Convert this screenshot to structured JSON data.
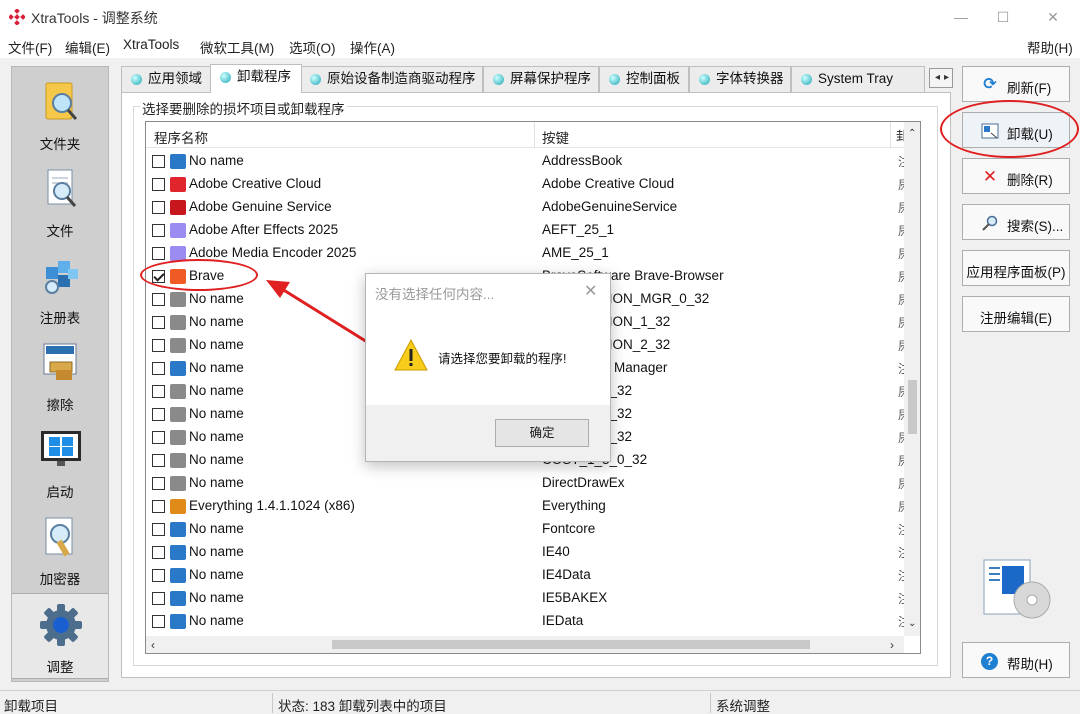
{
  "window": {
    "title": "XtraTools - 调整系统",
    "minimize": "—",
    "maximize": "☐",
    "close": "✕"
  },
  "menu": [
    {
      "label": "文件(F)"
    },
    {
      "label": "编辑(E)"
    },
    {
      "label": "XtraTools"
    },
    {
      "label": "微软工具(M)"
    },
    {
      "label": "选项(O)"
    },
    {
      "label": "操作(A)"
    }
  ],
  "menu_help": "帮助(H)",
  "leftbar": [
    {
      "label": "文件夹",
      "icon": "folder-icon"
    },
    {
      "label": "文件",
      "icon": "file-icon"
    },
    {
      "label": "注册表",
      "icon": "registry-icon"
    },
    {
      "label": "擦除",
      "icon": "eraser-icon"
    },
    {
      "label": "启动",
      "icon": "startup-icon"
    },
    {
      "label": "加密器",
      "icon": "encryptor-icon"
    },
    {
      "label": "调整",
      "icon": "gear-icon"
    }
  ],
  "tabs": [
    {
      "label": "应用领域"
    },
    {
      "label": "卸载程序"
    },
    {
      "label": "原始设备制造商驱动程序"
    },
    {
      "label": "屏幕保护程序"
    },
    {
      "label": "控制面板"
    },
    {
      "label": "字体转换器"
    },
    {
      "label": "System Tray"
    }
  ],
  "group_label": "选择要删除的损坏项目或卸载程序",
  "columns": {
    "name": "程序名称",
    "key": "按键",
    "extra": "卦"
  },
  "rows": [
    {
      "name": "No name",
      "key": "AddressBook",
      "extra": "注",
      "checked": false,
      "icon": "app-icon",
      "color": "#2a78c8"
    },
    {
      "name": "Adobe Creative Cloud",
      "key": "Adobe Creative Cloud",
      "extra": "屄",
      "checked": false,
      "icon": "creative-cloud-icon",
      "color": "#e0262c"
    },
    {
      "name": "Adobe Genuine Service",
      "key": "AdobeGenuineService",
      "extra": "屄",
      "checked": false,
      "icon": "adobe-icon",
      "color": "#c8161d"
    },
    {
      "name": "Adobe After Effects 2025",
      "key": "AEFT_25_1",
      "extra": "屄",
      "checked": false,
      "icon": "after-effects-icon",
      "color": "#9a8cf0"
    },
    {
      "name": "Adobe Media Encoder 2025",
      "key": "AME_25_1",
      "extra": "屄",
      "checked": false,
      "icon": "media-encoder-icon",
      "color": "#9a8cf0"
    },
    {
      "name": "Brave",
      "key": "BraveSoftware Brave-Browser",
      "extra": "屄",
      "checked": true,
      "icon": "brave-icon",
      "color": "#f05a24"
    },
    {
      "name": "No name",
      "key": "CONNECTION_MGR_0_32",
      "extra": "屄",
      "checked": false,
      "icon": "installer-icon",
      "color": "#8a8a8a"
    },
    {
      "name": "No name",
      "key": "CONNECTION_1_32",
      "extra": "屄",
      "checked": false,
      "icon": "installer-icon",
      "color": "#8a8a8a"
    },
    {
      "name": "No name",
      "key": "CONNECTION_2_32",
      "extra": "屄",
      "checked": false,
      "icon": "installer-icon",
      "color": "#8a8a8a"
    },
    {
      "name": "No name",
      "key": "Connection Manager",
      "extra": "注",
      "checked": false,
      "icon": "app-icon",
      "color": "#2a78c8"
    },
    {
      "name": "No name",
      "key": "COST_1_0_32",
      "extra": "屄",
      "checked": false,
      "icon": "installer-icon",
      "color": "#8a8a8a"
    },
    {
      "name": "No name",
      "key": "COST_1_1_32",
      "extra": "屄",
      "checked": false,
      "icon": "installer-icon",
      "color": "#8a8a8a"
    },
    {
      "name": "No name",
      "key": "COST_1_2_32",
      "extra": "屄",
      "checked": false,
      "icon": "installer-icon",
      "color": "#8a8a8a"
    },
    {
      "name": "No name",
      "key": "COST_1_3_0_32",
      "extra": "屄",
      "checked": false,
      "icon": "installer-icon",
      "color": "#8a8a8a"
    },
    {
      "name": "No name",
      "key": "DirectDrawEx",
      "extra": "屄",
      "checked": false,
      "icon": "installer-icon",
      "color": "#8a8a8a"
    },
    {
      "name": "Everything 1.4.1.1024 (x86)",
      "key": "Everything",
      "extra": "屄",
      "checked": false,
      "icon": "search-icon",
      "color": "#e08a1a"
    },
    {
      "name": "No name",
      "key": "Fontcore",
      "extra": "注",
      "checked": false,
      "icon": "app-icon",
      "color": "#2a78c8"
    },
    {
      "name": "No name",
      "key": "IE40",
      "extra": "注",
      "checked": false,
      "icon": "app-icon",
      "color": "#2a78c8"
    },
    {
      "name": "No name",
      "key": "IE4Data",
      "extra": "注",
      "checked": false,
      "icon": "app-icon",
      "color": "#2a78c8"
    },
    {
      "name": "No name",
      "key": "IE5BAKEX",
      "extra": "注",
      "checked": false,
      "icon": "app-icon",
      "color": "#2a78c8"
    },
    {
      "name": "No name",
      "key": "IEData",
      "extra": "注",
      "checked": false,
      "icon": "app-icon",
      "color": "#2a78c8"
    }
  ],
  "buttons": {
    "refresh": "刷新(F)",
    "uninstall": "卸载(U)",
    "delete": "删除(R)",
    "search": "搜索(S)...",
    "control_panel": "应用程序面板(P)",
    "registry_edit": "注册编辑(E)",
    "help": "帮助(H)"
  },
  "dialog": {
    "title": "没有选择任何内容...",
    "message": "请选择您要卸载的程序!",
    "ok": "确定",
    "close": "✕"
  },
  "status": {
    "left": "卸载项目",
    "middle": "状态:  183 卸载列表中的项目",
    "right": "系统调整"
  },
  "colors": {
    "accent": "#1fa6b5",
    "highlight": "#e02020",
    "frame": "#f0f0f0"
  }
}
